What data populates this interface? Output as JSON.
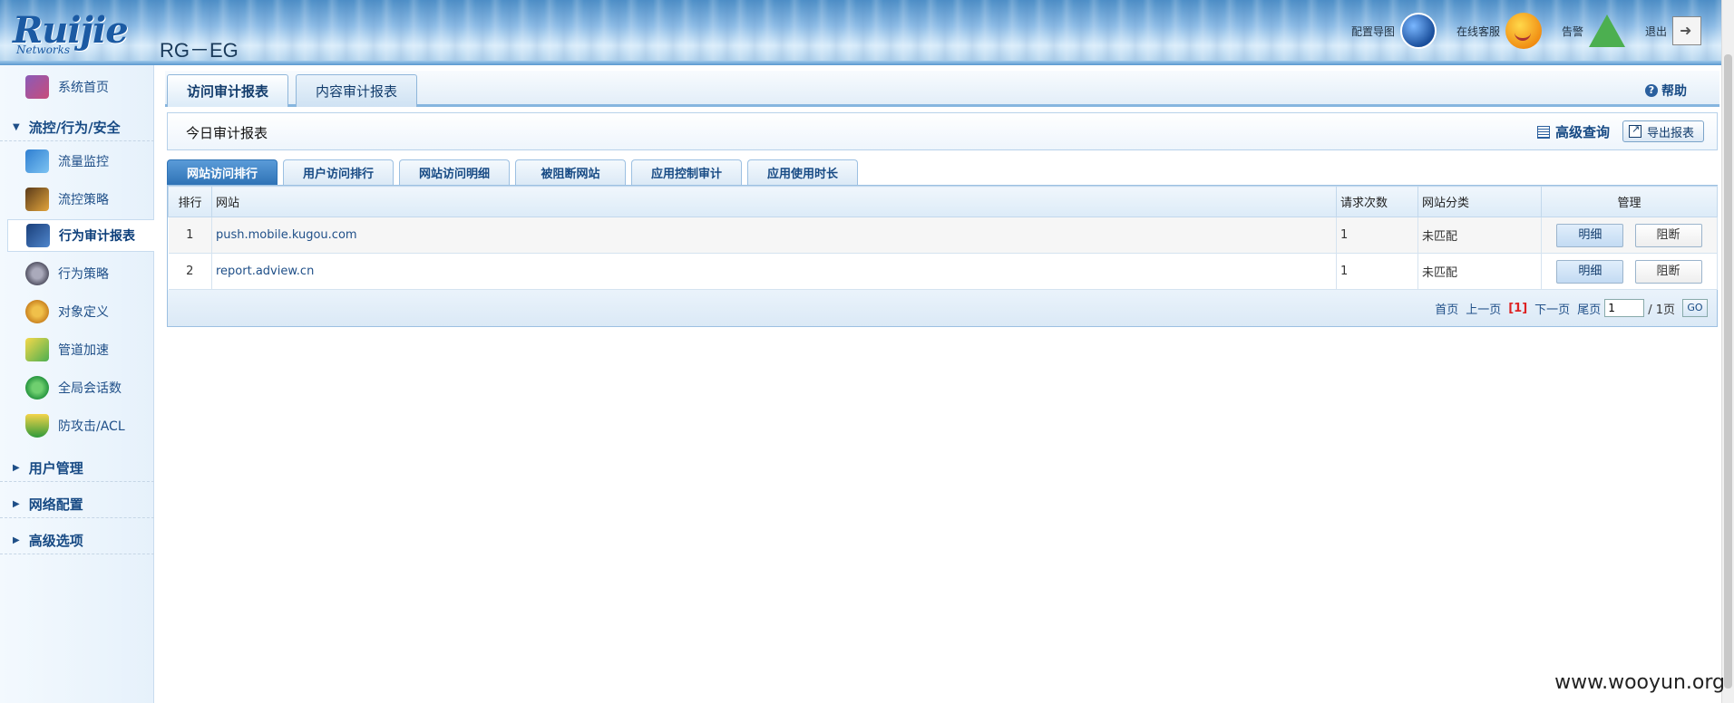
{
  "header": {
    "brand": "Ruijie",
    "brand_sub": "Networks",
    "model": "RG－EG",
    "links": [
      {
        "label": "配置导图",
        "icon": "globe-icon"
      },
      {
        "label": "在线客服",
        "icon": "smile-icon"
      },
      {
        "label": "告警",
        "icon": "alarm-icon"
      },
      {
        "label": "退出",
        "icon": "exit-icon"
      }
    ]
  },
  "sidebar": {
    "top_item": {
      "label": "系统首页",
      "icon": "monitor-icon"
    },
    "group_flow": {
      "label": "流控/行为/安全",
      "expanded": true
    },
    "items": [
      {
        "label": "流量监控",
        "icon": "traffic-icon"
      },
      {
        "label": "流控策略",
        "icon": "policy-icon"
      },
      {
        "label": "行为审计报表",
        "icon": "audit-icon",
        "active": true
      },
      {
        "label": "行为策略",
        "icon": "gear-icon"
      },
      {
        "label": "对象定义",
        "icon": "object-icon"
      },
      {
        "label": "管道加速",
        "icon": "accel-icon"
      },
      {
        "label": "全局会话数",
        "icon": "chat-icon"
      },
      {
        "label": "防攻击/ACL",
        "icon": "shield-icon"
      }
    ],
    "groups": [
      {
        "label": "用户管理"
      },
      {
        "label": "网络配置"
      },
      {
        "label": "高级选项"
      }
    ]
  },
  "main": {
    "tabs": [
      {
        "label": "访问审计报表",
        "active": true
      },
      {
        "label": "内容审计报表"
      }
    ],
    "help_label": "帮助",
    "panel_title": "今日审计报表",
    "advanced_query_label": "高级查询",
    "export_label": "导出报表",
    "sub_tabs": [
      {
        "label": "网站访问排行",
        "active": true
      },
      {
        "label": "用户访问排行"
      },
      {
        "label": "网站访问明细"
      },
      {
        "label": "被阻断网站"
      },
      {
        "label": "应用控制审计"
      },
      {
        "label": "应用使用时长"
      }
    ],
    "table": {
      "columns": [
        "排行",
        "网站",
        "请求次数",
        "网站分类",
        "管理"
      ],
      "rows": [
        {
          "rank": "1",
          "site": "push.mobile.kugou.com",
          "requests": "1",
          "category": "未匹配",
          "detail": "明细",
          "block": "阻断"
        },
        {
          "rank": "2",
          "site": "report.adview.cn",
          "requests": "1",
          "category": "未匹配",
          "detail": "明细",
          "block": "阻断"
        }
      ]
    },
    "pager": {
      "first": "首页",
      "prev": "上一页",
      "current": "[1]",
      "next": "下一页",
      "last": "尾页",
      "page_input": "1",
      "total": "/ 1页",
      "go": "GO"
    }
  },
  "watermark": "www.wooyun.org"
}
